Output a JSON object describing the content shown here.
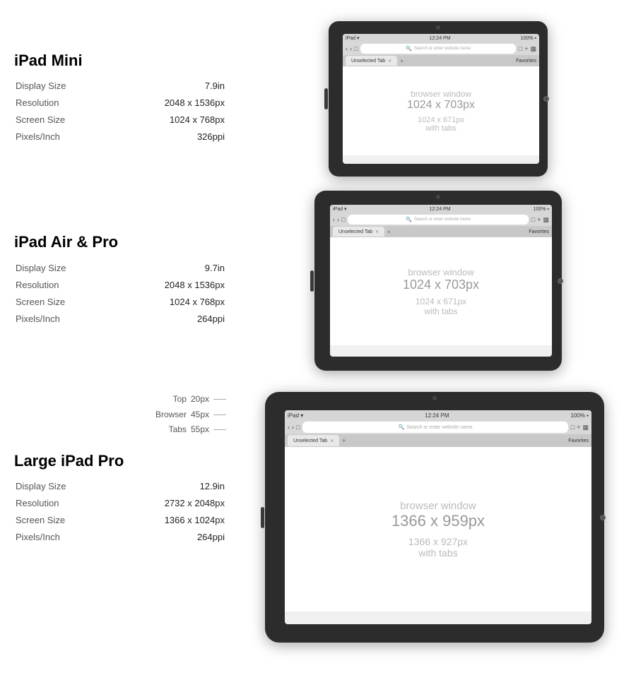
{
  "devices": [
    {
      "id": "mini",
      "title": "iPad Mini",
      "specs": [
        {
          "label": "Display Size",
          "value": "7.9in"
        },
        {
          "label": "Resolution",
          "value": "2048 x 1536px"
        },
        {
          "label": "Screen Size",
          "value": "1024 x 768px"
        },
        {
          "label": "Pixels/Inch",
          "value": "326ppi"
        }
      ],
      "browser": {
        "window_label": "browser window",
        "window_dim": "1024 x 703px",
        "sub_dim": "1024 x 671px",
        "sub_label": "with tabs",
        "status_left": "iPad ▾",
        "status_right": "100%",
        "time": "12:24 PM",
        "url_placeholder": "Search or enter website name",
        "tab_label": "Unselected Tab",
        "favorites_label": "Favorites"
      }
    },
    {
      "id": "air",
      "title": "iPad Air & Pro",
      "specs": [
        {
          "label": "Display Size",
          "value": "9.7in"
        },
        {
          "label": "Resolution",
          "value": "2048 x 1536px"
        },
        {
          "label": "Screen Size",
          "value": "1024 x 768px"
        },
        {
          "label": "Pixels/Inch",
          "value": "264ppi"
        }
      ],
      "browser": {
        "window_label": "browser window",
        "window_dim": "1024 x 703px",
        "sub_dim": "1024 x 671px",
        "sub_label": "with tabs",
        "status_left": "iPad ▾",
        "status_right": "100%",
        "time": "12:24 PM",
        "url_placeholder": "Search or enter website name",
        "tab_label": "Unselected Tab",
        "favorites_label": "Favorites"
      }
    },
    {
      "id": "large",
      "title": "Large iPad Pro",
      "annotations": [
        {
          "label": "Top",
          "value": "20px"
        },
        {
          "label": "Browser",
          "value": "45px"
        },
        {
          "label": "Tabs",
          "value": "55px"
        }
      ],
      "specs": [
        {
          "label": "Display Size",
          "value": "12.9in"
        },
        {
          "label": "Resolution",
          "value": "2732 x 2048px"
        },
        {
          "label": "Screen Size",
          "value": "1366 x 1024px"
        },
        {
          "label": "Pixels/Inch",
          "value": "264ppi"
        }
      ],
      "browser": {
        "window_label": "browser window",
        "window_dim": "1366 x 959px",
        "sub_dim": "1366 x 927px",
        "sub_label": "with tabs",
        "status_left": "iPad ▾",
        "status_right": "100%",
        "time": "12:24 PM",
        "url_placeholder": "Search or enter website name",
        "tab_label": "Unselected Tab",
        "favorites_label": "Favorites"
      }
    }
  ]
}
